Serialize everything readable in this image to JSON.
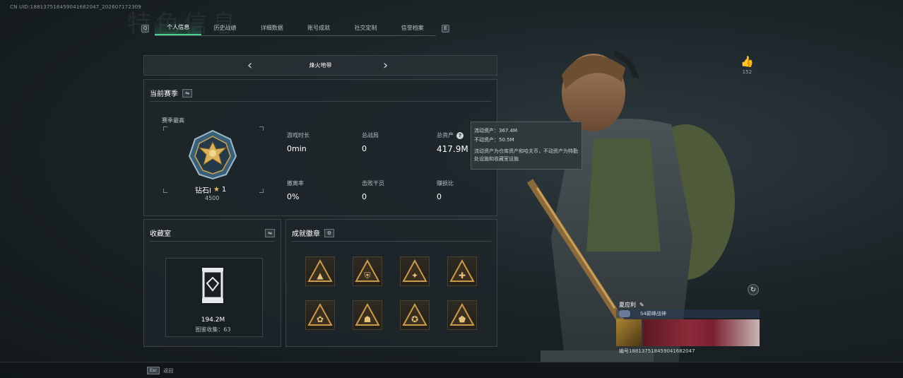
{
  "uid_text": "CN UID:1881375184590416820​47_202607172309",
  "bg_title": "特色信息",
  "tabs": {
    "prev_key": "Q",
    "next_key": "E",
    "items": [
      "个人信息",
      "历史战绩",
      "详细数据",
      "账号成就",
      "社交定制",
      "信誉档案"
    ],
    "active_index": 0
  },
  "mode": {
    "name": "烽火地带",
    "prev": "‹",
    "next": "›"
  },
  "season": {
    "title": "当前赛季",
    "switch_icon": "⇋",
    "best_label": "赛季最高",
    "rank_name": "钻石Ⅰ",
    "rank_stars": "1",
    "rank_points": "4500",
    "stats": [
      {
        "label": "游戏时长",
        "value": "0min"
      },
      {
        "label": "总战局",
        "value": "0"
      },
      {
        "label": "总资产",
        "value": "417.9M"
      },
      {
        "label": "撤离率",
        "value": "0%"
      },
      {
        "label": "击败干员",
        "value": "0"
      },
      {
        "label": "赚损比",
        "value": "0"
      }
    ]
  },
  "tooltip": {
    "liquid": "流动资产：367.4M",
    "fixed": "不动资产：50.5M",
    "desc": "流动资产为仓库资产和哈夫币，不动资产为特勤处设施和收藏室设施"
  },
  "collection": {
    "title": "收藏室",
    "switch_icon": "⇋",
    "value": "194.2M",
    "count_text": "图鉴收集：63"
  },
  "badges": {
    "title": "成就徽章",
    "settings_icon": "gear-icon",
    "count": 8
  },
  "likes": {
    "icon": "👍",
    "count": "152"
  },
  "player": {
    "name": "夏应利",
    "title_text": "S4巅峰战神",
    "id_text": "编号1881375184590416820​47"
  },
  "bottom": {
    "esc_key": "Esc",
    "esc_label": "返回"
  },
  "colors": {
    "accent": "#47d38f",
    "gold": "#e3c05a",
    "panel": "#1e262a"
  }
}
